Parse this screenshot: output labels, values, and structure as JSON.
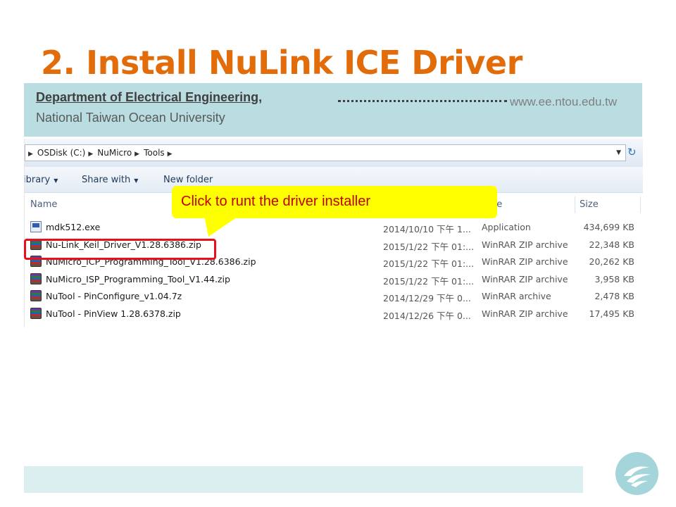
{
  "slide": {
    "title": "2. Install NuLink ICE Driver",
    "dept_line1": "Department of Electrical Engineering,",
    "dept_line2": "National Taiwan Ocean University",
    "url": "www.ee.ntou.edu.tw"
  },
  "explorer": {
    "breadcrumb": [
      "OSDisk (C:)",
      "NuMicro",
      "Tools"
    ],
    "toolbar": {
      "library_label": "ibrary",
      "share_label": "Share with",
      "newfolder_label": "New folder"
    },
    "columns": {
      "name": "Name",
      "type_partial": "pe",
      "size": "Size"
    },
    "files": [
      {
        "name": "mdk512.exe",
        "date": "2014/10/10 下午 1...",
        "type": "Application",
        "size": "434,699 KB",
        "icon": "exe-icon"
      },
      {
        "name": "Nu-Link_Keil_Driver_V1.28.6386.zip",
        "date": "2015/1/22 下午 01:...",
        "type": "WinRAR ZIP archive",
        "size": "22,348 KB",
        "icon": "winrar-icon"
      },
      {
        "name": "NuMicro_ICP_Programming_Tool_V1.28.6386.zip",
        "date": "2015/1/22 下午 01:...",
        "type": "WinRAR ZIP archive",
        "size": "20,262 KB",
        "icon": "winrar-icon"
      },
      {
        "name": "NuMicro_ISP_Programming_Tool_V1.44.zip",
        "date": "2015/1/22 下午 01:...",
        "type": "WinRAR ZIP archive",
        "size": "3,958 KB",
        "icon": "winrar-icon"
      },
      {
        "name": "NuTool - PinConfigure_v1.04.7z",
        "date": "2014/12/29 下午 0...",
        "type": "WinRAR archive",
        "size": "2,478 KB",
        "icon": "winrar-icon"
      },
      {
        "name": "NuTool - PinView 1.28.6378.zip",
        "date": "2014/12/26 下午 0...",
        "type": "WinRAR ZIP archive",
        "size": "17,495 KB",
        "icon": "winrar-icon"
      }
    ]
  },
  "callout": {
    "text": "Click to runt the driver installer"
  },
  "colors": {
    "title": "#e36c0a",
    "banner": "#b9dde1",
    "callout_bg": "#ffff00",
    "callout_text": "#c00000",
    "highlight": "#e8101c",
    "footer": "#dbeef0",
    "logo": "#a4d5da"
  }
}
